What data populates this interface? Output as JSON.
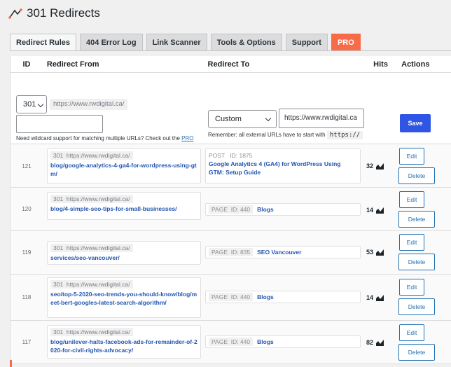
{
  "app": {
    "title": "301 Redirects"
  },
  "tabs": [
    {
      "label": "Redirect Rules"
    },
    {
      "label": "404 Error Log"
    },
    {
      "label": "Link Scanner"
    },
    {
      "label": "Tools & Options"
    },
    {
      "label": "Support"
    },
    {
      "label": "PRO"
    }
  ],
  "table": {
    "headers": {
      "id": "ID",
      "from": "Redirect From",
      "to": "Redirect To",
      "hits": "Hits",
      "actions": "Actions"
    }
  },
  "new_rule": {
    "status_code": "301",
    "domain_prefix": "https://www.rwdigital.ca/",
    "from_value": "",
    "wildcard_note": "Need wildcard support for matching multiple URLs? Check out the",
    "wildcard_link": "PRO version.",
    "redirect_type": "Custom",
    "to_value": "https://www.rwdigital.ca",
    "external_note": "Remember: all external URLs have to start with",
    "external_code": "https://",
    "save_label": "Save"
  },
  "rows": [
    {
      "id": "121",
      "status": "301",
      "prefix": "https://www.rwdigital.ca/",
      "path": "blog/google-analytics-4-ga4-for-wordpress-using-gtm/",
      "to_type": "POST",
      "to_id": "ID: 1875",
      "to_title": "Google Analytics 4 (GA4) for WordPress Using GTM: Setup Guide",
      "hits": "32"
    },
    {
      "id": "120",
      "status": "301",
      "prefix": "https://www.rwdigital.ca/",
      "path": "blog/4-simple-seo-tips-for-small-businesses/",
      "to_type": "PAGE",
      "to_id": "ID: 440",
      "to_title": "Blogs",
      "hits": "14"
    },
    {
      "id": "119",
      "status": "301",
      "prefix": "https://www.rwdigital.ca/",
      "path": "services/seo-vancouver/",
      "to_type": "PAGE",
      "to_id": "ID: 835",
      "to_title": "SEO Vancouver",
      "hits": "53"
    },
    {
      "id": "118",
      "status": "301",
      "prefix": "https://www.rwdigital.ca/",
      "path": "seo/top-5-2020-seo-trends-you-should-know/blog/meet-bert-googles-latest-search-algorithm/",
      "to_type": "PAGE",
      "to_id": "ID: 440",
      "to_title": "Blogs",
      "hits": "14"
    },
    {
      "id": "117",
      "status": "301",
      "prefix": "https://www.rwdigital.ca/",
      "path": "blog/unilever-halts-facebook-ads-for-remainder-of-2020-for-civil-rights-advocacy/",
      "to_type": "PAGE",
      "to_id": "ID: 440",
      "to_title": "Blogs",
      "hits": "82"
    }
  ],
  "row_actions": {
    "edit": "Edit",
    "delete": "Delete"
  }
}
